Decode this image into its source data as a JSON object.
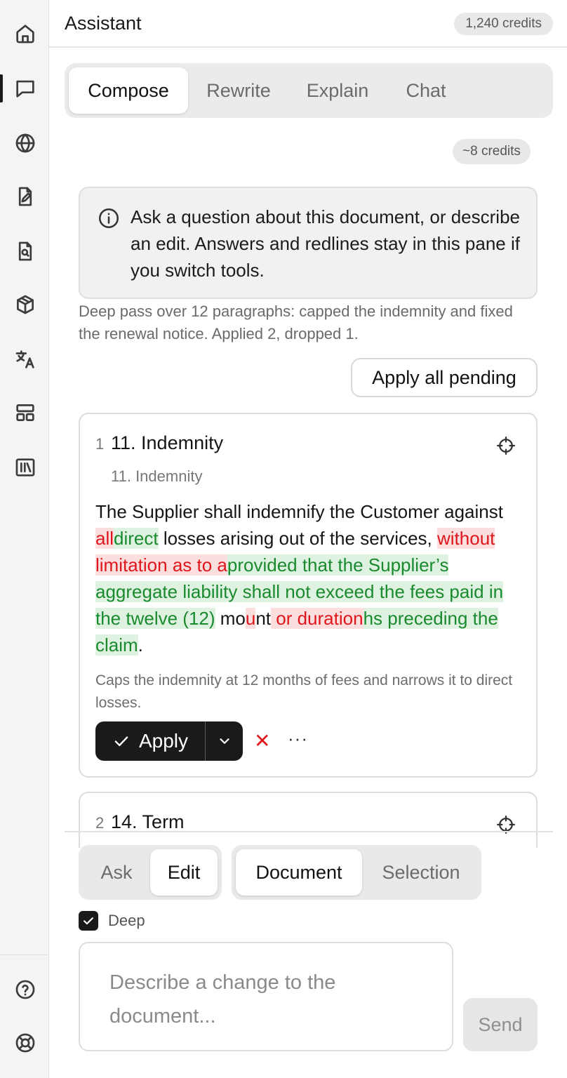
{
  "rail": {
    "items": [
      {
        "icon": "home-icon"
      },
      {
        "icon": "chat-icon",
        "active": true
      },
      {
        "icon": "globe-icon"
      },
      {
        "icon": "document-edit-icon"
      },
      {
        "icon": "document-search-icon"
      },
      {
        "icon": "cube-icon"
      },
      {
        "icon": "translate-icon"
      },
      {
        "icon": "layout-icon"
      },
      {
        "icon": "library-icon"
      }
    ],
    "bottom": [
      {
        "icon": "help-icon"
      },
      {
        "icon": "lifebuoy-icon"
      }
    ]
  },
  "header": {
    "title": "Assistant",
    "credits": "1,240 credits"
  },
  "mode_tabs": {
    "items": [
      {
        "label": "Compose",
        "active": true
      },
      {
        "label": "Rewrite"
      },
      {
        "label": "Explain"
      },
      {
        "label": "Chat"
      }
    ]
  },
  "cost_estimate": "~8 credits",
  "info": {
    "text": "Ask a question about this document, or describe an edit. Answers and redlines stay in this pane if you switch tools."
  },
  "summary": "Deep pass over 12 paragraphs: capped the indemnity and fixed the renewal notice. Applied 2, dropped 1.",
  "apply_all_label": "Apply all pending",
  "edits": [
    {
      "number": "1",
      "title": "11. Indemnity",
      "section": "11. Indemnity",
      "body": {
        "t1": "The Supplier shall indemnify the Customer against ",
        "d1": "all",
        "i1": "direct",
        "t2": " losses arising out of the services, ",
        "d2": "without limitation as to a",
        "i2": "provided that the Supplier’s aggregate liability shall not exceed the fees paid in the twelve (12)",
        "t3": " mo",
        "d3": "u",
        "t4": "nt",
        "d4": " or duration",
        "i3": "hs preceding the claim",
        "t5": "."
      },
      "note": "Caps the indemnity at 12 months of fees and narrows it to direct losses.",
      "apply_label": "Apply",
      "reject_glyph": "✕",
      "more_glyph": "···"
    },
    {
      "number": "2",
      "title": "14. Term"
    }
  ],
  "colors": {
    "deletion": "#e0161d",
    "insertion": "#1a8a2e",
    "primary_button": "#1a1a1a"
  },
  "composer": {
    "mode_tabs": [
      {
        "label": "Ask"
      },
      {
        "label": "Edit",
        "active": true
      }
    ],
    "scope_tabs": [
      {
        "label": "Document",
        "active": true
      },
      {
        "label": "Selection"
      }
    ],
    "deep_label": "Deep",
    "deep_checked": true,
    "placeholder": "Describe a change to the document...",
    "send_label": "Send"
  }
}
